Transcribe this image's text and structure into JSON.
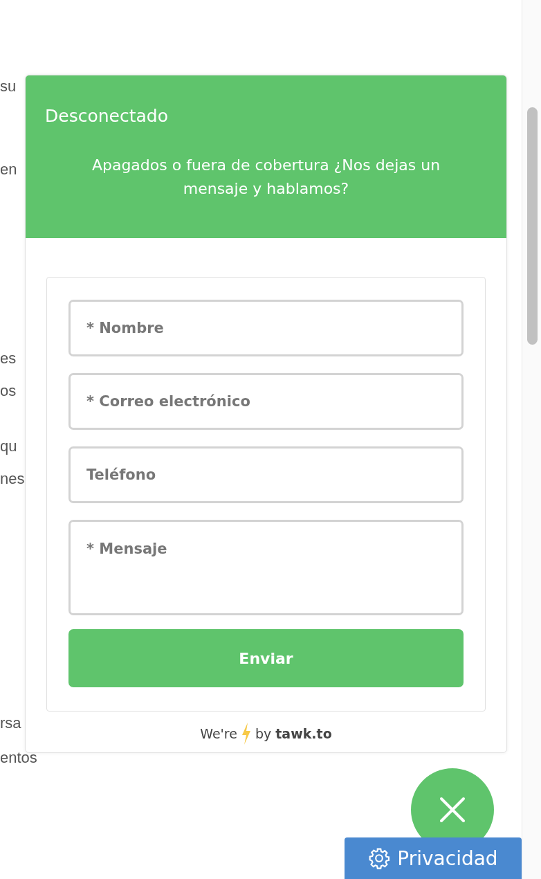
{
  "page_text": [
    "su",
    "en",
    "es",
    "os",
    "qu",
    "nes",
    "rsa",
    "entos"
  ],
  "chat_widget": {
    "status": "Desconectado",
    "message": "Apagados o fuera de cobertura ¿Nos dejas un mensaje y hablamos?",
    "fields": [
      {
        "kind": "input",
        "placeholder": "* Nombre"
      },
      {
        "kind": "input",
        "placeholder": "* Correo electrónico"
      },
      {
        "kind": "input",
        "placeholder": "Teléfono"
      },
      {
        "kind": "textarea",
        "placeholder": "* Mensaje"
      }
    ],
    "submit": "Enviar",
    "footer": {
      "before": "We're",
      "after": "by **tawk.to**"
    }
  },
  "privacy_button": {
    "label": "Privacidad"
  }
}
